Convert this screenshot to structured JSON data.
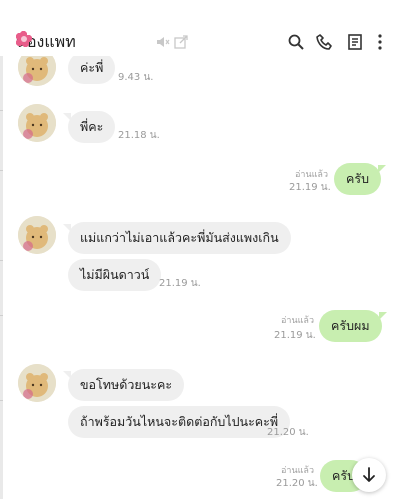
{
  "header": {
    "contact_name": "น้องแพท",
    "icons": [
      "flower-icon",
      "mute-icon",
      "open-external-icon",
      "search-icon",
      "phone-icon",
      "notes-icon",
      "more-vertical-icon"
    ]
  },
  "messages": {
    "m0": {
      "text": "ค่ะพี่",
      "time": "9.43 น."
    },
    "m1": {
      "text": "พี่คะ",
      "time": "21.18 น."
    },
    "m2": {
      "read": "อ่านแล้ว",
      "time": "21.19 น.",
      "text": "ครับ"
    },
    "m3": {
      "text": "แม่แกว่าไม่เอาแล้วคะพี่มันส่งแพงเกิน"
    },
    "m4": {
      "text": "ไม่มีผินดาวน์",
      "time": "21.19 น."
    },
    "m5": {
      "read": "อ่านแล้ว",
      "time": "21.19 น.",
      "text": "ครับผม"
    },
    "m6": {
      "text": "ขอโทษด้วยนะคะ"
    },
    "m7": {
      "text": "ถ้าพร้อมวันไหนจะติดต่อกับไปนะคะพี่",
      "time": "21.20 น."
    },
    "m8": {
      "read": "อ่านแล้ว",
      "time": "21.20 น.",
      "text": "ครับ"
    }
  },
  "colors": {
    "incoming_bubble": "#efefef",
    "outgoing_bubble": "#c8eeb0",
    "accent_flower": "#e85d8a"
  }
}
